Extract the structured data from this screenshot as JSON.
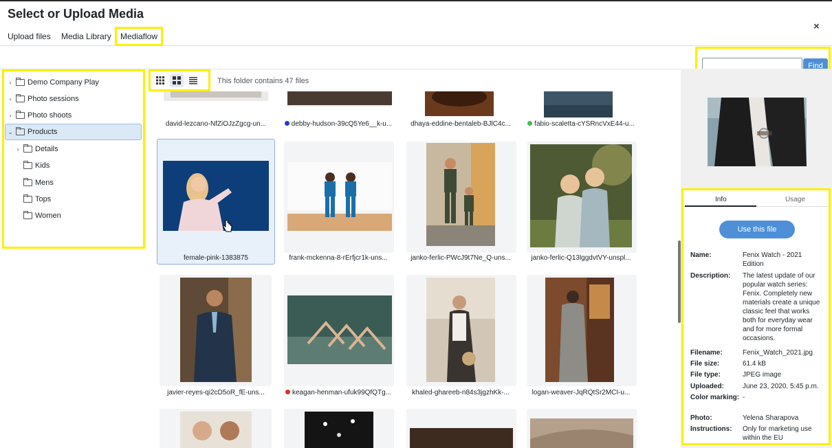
{
  "modal": {
    "title": "Select or Upload Media",
    "close": "×"
  },
  "tabs": [
    {
      "label": "Upload files"
    },
    {
      "label": "Media Library"
    },
    {
      "label": "Mediaflow"
    }
  ],
  "search": {
    "placeholder": "",
    "value": "",
    "button": "Find"
  },
  "tree": {
    "items": [
      {
        "label": "Demo Company Play",
        "chevron": "›"
      },
      {
        "label": "Photo sessions",
        "chevron": "›"
      },
      {
        "label": "Photo shoots",
        "chevron": "›"
      },
      {
        "label": "Products",
        "chevron": "⌄"
      },
      {
        "label": "Details",
        "chevron": "›"
      },
      {
        "label": "Kids",
        "chevron": ""
      },
      {
        "label": "Mens",
        "chevron": ""
      },
      {
        "label": "Tops",
        "chevron": ""
      },
      {
        "label": "Women",
        "chevron": ""
      }
    ]
  },
  "toolbar": {
    "folder_count": "This folder contains 47 files"
  },
  "files": [
    {
      "name": "david-lezcano-NfZiOJzZgcg-un...",
      "dot": ""
    },
    {
      "name": "debby-hudson-39cQ5Ye6__k-u...",
      "dot": "#1f3fbf"
    },
    {
      "name": "dhaya-eddine-bentaleb-BJlC4c...",
      "dot": ""
    },
    {
      "name": "fabio-scaletta-cYSRncVxE44-u...",
      "dot": "#3fbf4a"
    },
    {
      "name": "female-pink-1383875",
      "dot": ""
    },
    {
      "name": "frank-mckenna-8-rErfjcr1k-uns...",
      "dot": ""
    },
    {
      "name": "janko-ferlic-PWcJ9t7Ne_Q-uns...",
      "dot": ""
    },
    {
      "name": "janko-ferlic-Q13lggdvtVY-unspl...",
      "dot": ""
    },
    {
      "name": "javier-reyes-qi2cD5oR_fE-uns...",
      "dot": ""
    },
    {
      "name": "keagan-henman-ufuk99QfQTg...",
      "dot": "#d93025"
    },
    {
      "name": "khaled-ghareeb-n84s3jgzhKk-...",
      "dot": ""
    },
    {
      "name": "logan-weaver-JqRQtSr2MCI-u...",
      "dot": ""
    }
  ],
  "details": {
    "tabs": [
      "Info",
      "Usage"
    ],
    "use_button": "Use this file",
    "rows": [
      {
        "key": "Name:",
        "value": "Fenix Watch - 2021 Edition"
      },
      {
        "key": "Description:",
        "value": "The latest update of our popular watch series: Fenix. Completely new materials create a unique classic feel that works both for everyday wear and for more formal occasions."
      },
      {
        "key": "Filename:",
        "value": "Fenix_Watch_2021.jpg"
      },
      {
        "key": "File size:",
        "value": "61.4 kB"
      },
      {
        "key": "File type:",
        "value": "JPEG image"
      },
      {
        "key": "Uploaded:",
        "value": "June 23, 2020, 5:45 p.m."
      },
      {
        "key": "Color marking:",
        "value": "-"
      },
      {
        "key": "Photo:",
        "value": "Yelena Sharapova"
      },
      {
        "key": "Instructions:",
        "value": "Only for marketing use within the EU"
      }
    ]
  },
  "colors": {
    "accent": "#4e8fd8",
    "highlight": "#ffee00",
    "selected_bg": "#dbe9f6"
  },
  "icons": {
    "close": "close-icon",
    "folder": "folder-icon",
    "chevron": "chevron-icon",
    "view_small": "grid-small-icon",
    "view_large": "grid-large-icon",
    "view_list": "list-icon"
  }
}
